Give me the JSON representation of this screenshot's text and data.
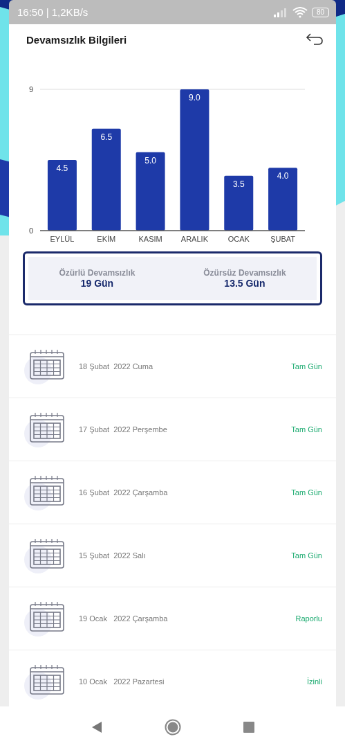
{
  "status_bar": {
    "time_speed": "16:50 | 1,2KB/s",
    "battery": "80"
  },
  "header": {
    "title": "Devamsızlık Bilgileri"
  },
  "chart": {
    "chart_data": {
      "type": "bar",
      "categories": [
        "EYLÜL",
        "EKİM",
        "KASIM",
        "ARALIK",
        "OCAK",
        "ŞUBAT"
      ],
      "series": [
        {
          "color": "#1e3aa8",
          "values": [
            4.5,
            6.5,
            5.0,
            9.0,
            3.5,
            4.0
          ]
        }
      ],
      "ylim": [
        0,
        9
      ],
      "yticks": [
        0,
        9
      ],
      "value_labels": [
        "4.5",
        "6.5",
        "5.0",
        "9.0",
        "3.5",
        "4.0"
      ]
    }
  },
  "summary": [
    {
      "label": "Özürlü Devamsızlık",
      "value": "19 Gün"
    },
    {
      "label": "Özürsüz Devamsızlık",
      "value": "13.5 Gün"
    }
  ],
  "records": [
    {
      "date": "18 Şubat  2022 Cuma",
      "status": "Tam Gün"
    },
    {
      "date": "17 Şubat  2022 Perşembe",
      "status": "Tam Gün"
    },
    {
      "date": "16 Şubat  2022 Çarşamba",
      "status": "Tam Gün"
    },
    {
      "date": "15 Şubat  2022 Salı",
      "status": "Tam Gün"
    },
    {
      "date": "19 Ocak   2022 Çarşamba",
      "status": "Raporlu"
    },
    {
      "date": "10 Ocak   2022 Pazartesi",
      "status": "İzinli"
    }
  ]
}
